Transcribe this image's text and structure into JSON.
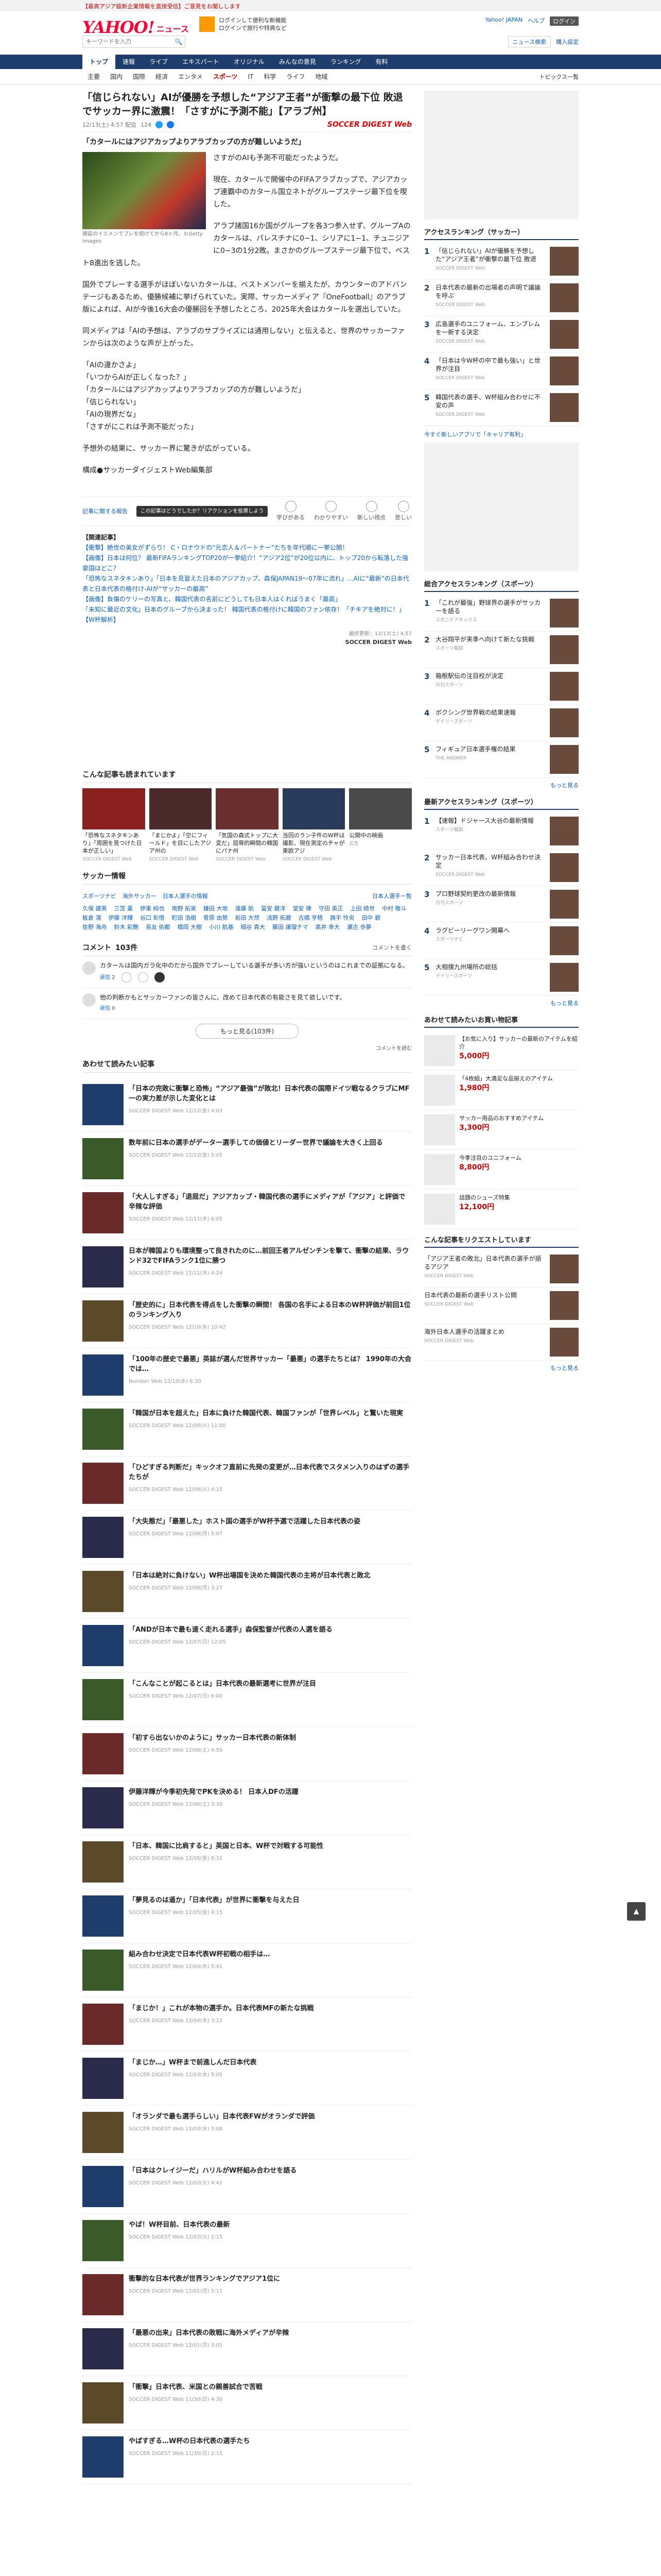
{
  "promo": "【最高アジア級新企業情報を直接受信】ご意見をお聞しします",
  "header": {
    "logo_text": "YAHOO!",
    "logo_sub": "ニュース",
    "ad_text_1": "ログインして便利な新機能",
    "ad_text_2": "ログインで旅行や特典など",
    "links": [
      "Yahoo! JAPAN",
      "ヘルプ",
      "ログイン"
    ],
    "search_placeholder": "キーワードを入力",
    "search_right": [
      "ニュース検索",
      "購入設定"
    ]
  },
  "cat_nav": [
    "トップ",
    "速報",
    "ライブ",
    "エキスパート",
    "オリジナル",
    "みんなの意見",
    "ランキング",
    "有料"
  ],
  "sub_nav": [
    "主要",
    "国内",
    "国際",
    "経済",
    "エンタメ",
    "スポーツ",
    "IT",
    "科学",
    "ライフ",
    "地域"
  ],
  "sub_nav_right": "トピックス一覧",
  "article": {
    "title": "「信じられない」AIが優勝を予想した“アジア王者”が衝撃の最下位 敗退でサッカー界に激震！「さすがに予測不能」【アラブ州】",
    "date": "12/13(土) 4:57 配信",
    "comments_count": "124",
    "media_logo": "SOCCER DIGEST Web",
    "lead": "「カタールにはアジアカップよりアラブカップの方が難しいようだ」",
    "photo_caption": "順延のイエメンでプレを続けてから8ヶ月。©Getty Images",
    "paragraphs": [
      "さすがのAIも予測不可能だったようだ。",
      "現在、カタールで開催中のFIFAアラブカップで、アジアカップ連覇中のカタール国立ネトがグループステージ最下位を喫した。",
      "アラブ諸国16か国がグループを各3つ参入せず、グループAのカタールは、パレスチナに0−1、シリアに1−1、チュニジアに0−3の1分2敗。まさかのグループステージ最下位で、ベスト8進出を逃した。",
      "国外でプレーする選手がほぼいないカタールは、ベストメンバーを揃えたが、カウンターのアドバンテージもあるため、優勝候補に挙げられていた。実際、サッカーメディア『OneFootball』のアラブ版によれば、AIが今後16大会の優勝回を予想したところ、2025年大会はカタールを選出していた。",
      "同メディアは「AIの予想は、アラブのサプライズには通用しない」と伝えると、世界のサッカーファンからは次のような声が上がった。",
      "「AIの違かさよ」\n「いつからAIが正しくなった？」\n「カタールにはアジアカップよりアラブカップの方が難しいようだ」\n「信じられない」\n「AIの現界だな」\n「さすがにこれは予測不能だった」",
      "予想外の結果に、サッカー界に驚きが広がっている。"
    ],
    "byline": "構成●サッカーダイジェストWeb編集部",
    "report_link": "記事に関する報告",
    "tooltip": "この記事はどうでしたか？リアクションを投票しよう",
    "reactions": [
      "学びがある",
      "わかりやすい",
      "新しい視点",
      "悲しい"
    ],
    "related_header": "【関連記事】",
    "related": [
      "【衝撃】絶世の美女がずらり！ C・ロナウドの“元恋人＆パートナー”たちを年代順に一挙公開！",
      "【画像】日本は何位？ 最新FIFAランキングTOP20が一挙紹介！“アジア2位”が20位以内に、トップ20から転落した強豪国はどこ？",
      "「恐怖なスネタキンあり」「日本を見習えた日本のアジアカップ、森保JAPAN19〜07年に流れ」…AIに“最新”の日本代表と日本代表の格付け-AIが“サッカーの最高”",
      "【画像】負傷のケリーの写真と、韓国代表の名前にどうしても日本人はくればうまく「最高」",
      "「未知に最近の文化」日本のグループから決まった！ 韓国代表の格付けに韓国のファン依存！「チキアを絶対に！」【W杯解析】"
    ],
    "source_date": "最終更新：12/13(土) 4:57",
    "source_name": "SOCCER DIGEST Web"
  },
  "recommend": {
    "header": "こんな記事も読まれています",
    "cards": [
      {
        "title": "「恐怖なスネタキンあり」「周囲を見つけた日本が正しい」",
        "src": "SOCCER DIGEST Web"
      },
      {
        "title": "「まじかよ」「空にフィールド」を目にしたアジア州の",
        "src": "SOCCER DIGEST Web"
      },
      {
        "title": "「気国の森式トップに大変だ」屈辱的瞬間の韓国にパナ州",
        "src": "SOCCER DIGEST Web"
      },
      {
        "title": "当回のラン子件のW杯は撮影、現在測定のチャが東欧アジ",
        "src": "SOCCER DIGEST Web"
      },
      {
        "title": "公開中の映画",
        "src": "広告"
      }
    ]
  },
  "soccer_info": {
    "header": "サッカー情報",
    "tabs": [
      "スポーツナビ",
      "海外サッカー",
      "日本人選手の情報",
      "日本人選手一覧"
    ],
    "players": [
      "久保 建英",
      "三笘 薫",
      "伊東 純也",
      "南野 拓実",
      "鎌田 大地",
      "遠藤 航",
      "冨安 健洋",
      "堂安 律",
      "守田 英正",
      "上田 綺世",
      "中村 敬斗",
      "板倉 滉",
      "伊藤 洋輝",
      "谷口 彰悟",
      "町田 浩樹",
      "菅原 由勢",
      "前田 大然",
      "浅野 拓磨",
      "古橋 亨梧",
      "旗手 怜央",
      "田中 碧",
      "佐野 海舟",
      "鈴木 彩艶",
      "長友 佑都",
      "橋岡 大樹",
      "小川 航基",
      "細谷 真大",
      "藤田 譲瑠チマ",
      "高井 幸大",
      "瀬古 歩夢"
    ]
  },
  "comments": {
    "header": "コメント",
    "count": "103件",
    "right": "コメントを書く",
    "items": [
      {
        "text": "カタールは国内ガラ化中のだから国外でプレーしている選手が多い方が強いというのはこれまでの証拠になる。",
        "meta": "返信 2"
      },
      {
        "text": "他の判断かもとサッカーファンの皆さんに、改めて日本代表の有能さを見て欲しいです。",
        "meta": "返信 0"
      }
    ],
    "more": "もっと見る(103件)",
    "foot": "コメントを読む"
  },
  "feed": {
    "header": "あわせて読みたい記事",
    "items": [
      {
        "title": "「日本の完敗に衝撃と恐怖」“アジア最強”が敗北！日本代表の国際ドイツ戦なるクラブにMF一の実力差が示した変化とは",
        "meta": "SOCCER DIGEST Web 12/12(金) 4:03"
      },
      {
        "title": "数年前に日本の選手がデーター選手しての価値とリーダー世界で議論を大きく上回る",
        "meta": "SOCCER DIGEST Web 12/12(金) 5:05"
      },
      {
        "title": "「大人しすぎる」「退屈だ」アジアカップ・韓国代表の選手にメディアが「アジア」と評価で辛辣な評価",
        "meta": "SOCCER DIGEST Web 12/11(木) 6:05"
      },
      {
        "title": "日本が韓国よりも環境整って良きれたのに…前回王者アルゼンチンを撃て、衝撃の結果、ラウンド32でFIFAランク1位に勝つ",
        "meta": "SOCCER DIGEST Web 12/11(木) 4:24"
      },
      {
        "title": "「歴史的に」日本代表を得点をした衝撃の瞬間！ 各国の名手による日本のW杯評価が前回1位のランキング入り",
        "meta": "SOCCER DIGEST Web 12/10(水) 10:42"
      },
      {
        "title": "「100年の歴史で最悪」英誌が選んだ世界サッカー「最悪」の選手たちとは？ 1990年の大会では…",
        "meta": "Number Web 12/10(水) 6:30"
      },
      {
        "title": "「韓国が日本を超えた」日本に負けた韓国代表、韓国ファンが「世界レベル」と驚いた現実",
        "meta": "SOCCER DIGEST Web 12/09(火) 11:00"
      },
      {
        "title": "「ひどすぎる判断だ」キックオフ直前に先発の変更が…日本代表でスタメン入りのはずの選手たちが",
        "meta": "SOCCER DIGEST Web 12/09(火) 4:15"
      },
      {
        "title": "「大失態だ」「最悪した」ホスト国の選手がW杯予選で活躍した日本代表の姿",
        "meta": "SOCCER DIGEST Web 12/08(月) 5:07"
      },
      {
        "title": "「日本は絶対に負けない」W杯出場国を決めた韓国代表の主将が日本代表と敗北",
        "meta": "SOCCER DIGEST Web 12/08(月) 3:27"
      },
      {
        "title": "「ANDが日本で最も速く走れる選手」森保監督が代表の人選を語る",
        "meta": "SOCCER DIGEST Web 12/07(日) 12:05"
      },
      {
        "title": "「こんなことが起こるとは」日本代表の最新選考に世界が注目",
        "meta": "SOCCER DIGEST Web 12/07(日) 6:00"
      },
      {
        "title": "「初すら出ないかのように」サッカー日本代表の新体制",
        "meta": "SOCCER DIGEST Web 12/06(土) 4:50"
      },
      {
        "title": "伊藤洋輝が今季初先発でPKを決める！ 日本人DFの活躍",
        "meta": "SOCCER DIGEST Web 12/06(土) 3:30"
      },
      {
        "title": "「日本、韓国に比肩すると」英国と日本、W杯で対戦する可能性",
        "meta": "SOCCER DIGEST Web 12/05(金) 8:32"
      },
      {
        "title": "「夢見るのは遥か」「日本代表」が世界に衝撃を与えた日",
        "meta": "SOCCER DIGEST Web 12/05(金) 4:15"
      },
      {
        "title": "組み合わせ決定で日本代表W杯初戦の相手は…",
        "meta": "SOCCER DIGEST Web 12/04(木) 5:41"
      },
      {
        "title": "「まじか！」これが本物の選手か。日本代表MFの新たな挑戦",
        "meta": "SOCCER DIGEST Web 12/04(木) 3:12"
      },
      {
        "title": "「まじか…」W杯まで前進しんだ日本代表",
        "meta": "SOCCER DIGEST Web 12/03(水) 5:05"
      },
      {
        "title": "「オランダで最も選手らしい」日本代表FWがオランダで評価",
        "meta": "SOCCER DIGEST Web 12/03(水) 3:08"
      },
      {
        "title": "「日本はクレイジーだ」ハリルがW杯組み合わせを語る",
        "meta": "SOCCER DIGEST Web 12/02(火) 4:42"
      },
      {
        "title": "やば！W杯目前、日本代表の最新",
        "meta": "SOCCER DIGEST Web 12/02(火) 2:15"
      },
      {
        "title": "衝撃的な日本代表が世界ランキングでアジア1位に",
        "meta": "SOCCER DIGEST Web 12/01(月) 5:11"
      },
      {
        "title": "「最悪の出来」日本代表の敗戦に海外メディアが辛辣",
        "meta": "SOCCER DIGEST Web 12/01(月) 3:01"
      },
      {
        "title": "「衝撃」日本代表、米国との親善試合で苦戦",
        "meta": "SOCCER DIGEST Web 11/30(日) 4:30"
      },
      {
        "title": "やばすぎる…W杯の日本代表の選手たち",
        "meta": "SOCCER DIGEST Web 11/30(日) 2:15"
      }
    ]
  },
  "sidebar": {
    "ranking_header": "アクセスランキング（サッカー）",
    "ranking": [
      {
        "no": "1",
        "text": "「信じられない」AIが優勝を予想した“アジア王者”が衝撃の最下位 敗退",
        "src": "SOCCER DIGEST Web"
      },
      {
        "no": "2",
        "text": "日本代表の最新の出場者の声明で議論を呼ぶ",
        "src": "SOCCER DIGEST Web"
      },
      {
        "no": "3",
        "text": "広島選手のユニフォーム、エンブレムを一新する決定",
        "src": "SOCCER DIGEST Web"
      },
      {
        "no": "4",
        "text": "「日本は今W杯の中で最も強い」と世界が注目",
        "src": "SOCCER DIGEST Web"
      },
      {
        "no": "5",
        "text": "韓国代表の選手、W杯組み合わせに不安の声",
        "src": "SOCCER DIGEST Web"
      }
    ],
    "link1": "今すぐ新しいアプリで「キャリア有利」",
    "ranking2_header": "総合アクセスランキング（スポーツ）",
    "ranking2": [
      {
        "no": "1",
        "text": "「これが最強」野球界の選手がサッカーを語る",
        "src": "スポニチアネックス"
      },
      {
        "no": "2",
        "text": "大谷翔平が来季へ向けて新たな挑戦",
        "src": "スポーツ報知"
      },
      {
        "no": "3",
        "text": "箱根駅伝の注目校が決定",
        "src": "日刊スポーツ"
      },
      {
        "no": "4",
        "text": "ボクシング世界戦の結果速報",
        "src": "デイリースポーツ"
      },
      {
        "no": "5",
        "text": "フィギュア日本選手権の結果",
        "src": "THE ANSWER"
      }
    ],
    "ranking3_header": "最新アクセスランキング（スポーツ）",
    "ranking3": [
      {
        "no": "1",
        "text": "【速報】ドジャース大谷の最新情報",
        "src": "スポーツ報知"
      },
      {
        "no": "2",
        "text": "サッカー日本代表、W杯組み合わせ決定",
        "src": "SOCCER DIGEST Web"
      },
      {
        "no": "3",
        "text": "プロ野球契約更改の最新情報",
        "src": "日刊スポーツ"
      },
      {
        "no": "4",
        "text": "ラグビーリーグワン開幕へ",
        "src": "スポーツナビ"
      },
      {
        "no": "5",
        "text": "大相撲九州場所の総括",
        "src": "デイリースポーツ"
      }
    ],
    "more": "もっと見る",
    "shop_header": "あわせて読みたいお買い物記事",
    "shop": [
      {
        "text": "【お気に入り】サッカーの最新のアイテムを紹介",
        "price": "5,000円"
      },
      {
        "text": "「4枚組」大満足な品揃えのアイテム",
        "price": "1,980円"
      },
      {
        "text": "サッカー用品のおすすめアイテム",
        "price": "3,300円"
      },
      {
        "text": "今季注目のユニフォーム",
        "price": "8,800円"
      },
      {
        "text": "話題のシューズ特集",
        "price": "12,100円"
      }
    ],
    "news_header": "こんな記事をリクエストしています",
    "news": [
      {
        "text": "「アジア王者の敗北」日本代表の選手が語るアジア",
        "src": "SOCCER DIGEST Web"
      },
      {
        "text": "日本代表の最新の選手リスト公開",
        "src": "SOCCER DIGEST Web"
      },
      {
        "text": "海外日本人選手の活躍まとめ",
        "src": "SOCCER DIGEST Web"
      }
    ],
    "news_more": "もっと見る"
  }
}
